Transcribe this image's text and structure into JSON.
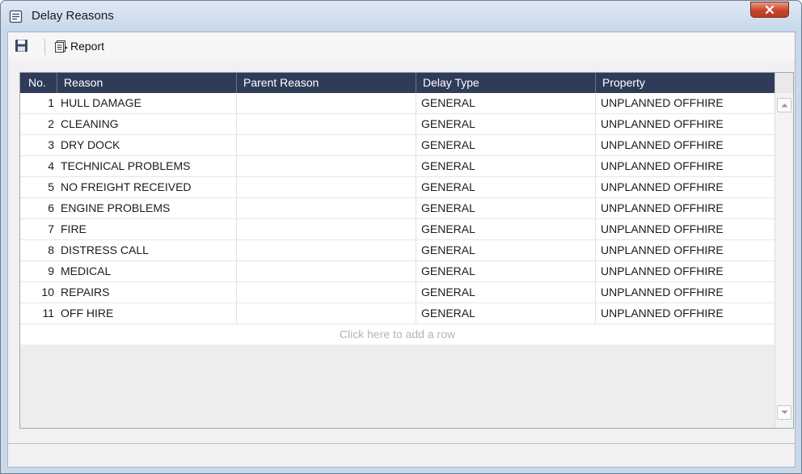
{
  "window": {
    "title": "Delay Reasons",
    "close_label": "x"
  },
  "toolbar": {
    "report_label": "Report"
  },
  "grid": {
    "columns": {
      "no": "No.",
      "reason": "Reason",
      "parent_reason": "Parent Reason",
      "delay_type": "Delay Type",
      "property": "Property"
    },
    "rows": [
      {
        "no": "1",
        "reason": "HULL DAMAGE",
        "parent_reason": "",
        "delay_type": "GENERAL",
        "property": "UNPLANNED OFFHIRE"
      },
      {
        "no": "2",
        "reason": "CLEANING",
        "parent_reason": "",
        "delay_type": "GENERAL",
        "property": "UNPLANNED OFFHIRE"
      },
      {
        "no": "3",
        "reason": "DRY DOCK",
        "parent_reason": "",
        "delay_type": "GENERAL",
        "property": "UNPLANNED OFFHIRE"
      },
      {
        "no": "4",
        "reason": "TECHNICAL PROBLEMS",
        "parent_reason": "",
        "delay_type": "GENERAL",
        "property": "UNPLANNED OFFHIRE"
      },
      {
        "no": "5",
        "reason": "NO FREIGHT RECEIVED",
        "parent_reason": "",
        "delay_type": "GENERAL",
        "property": "UNPLANNED OFFHIRE"
      },
      {
        "no": "6",
        "reason": "ENGINE PROBLEMS",
        "parent_reason": "",
        "delay_type": "GENERAL",
        "property": "UNPLANNED OFFHIRE"
      },
      {
        "no": "7",
        "reason": "FIRE",
        "parent_reason": "",
        "delay_type": "GENERAL",
        "property": "UNPLANNED OFFHIRE"
      },
      {
        "no": "8",
        "reason": "DISTRESS CALL",
        "parent_reason": "",
        "delay_type": "GENERAL",
        "property": "UNPLANNED OFFHIRE"
      },
      {
        "no": "9",
        "reason": "MEDICAL",
        "parent_reason": "",
        "delay_type": "GENERAL",
        "property": "UNPLANNED OFFHIRE"
      },
      {
        "no": "10",
        "reason": "REPAIRS",
        "parent_reason": "",
        "delay_type": "GENERAL",
        "property": "UNPLANNED OFFHIRE"
      },
      {
        "no": "11",
        "reason": "OFF HIRE",
        "parent_reason": "",
        "delay_type": "GENERAL",
        "property": "UNPLANNED OFFHIRE"
      }
    ],
    "add_row_text": "Click here to add a row"
  },
  "icons": {
    "app": "form-icon",
    "save": "save-icon",
    "report": "report-icon",
    "scroll_up": "chevron-up-icon",
    "scroll_down": "chevron-down-icon"
  },
  "colors": {
    "header_bg": "#2f3b58",
    "close_bg": "#c7442b",
    "add_row_text": "#b5b5b5"
  }
}
